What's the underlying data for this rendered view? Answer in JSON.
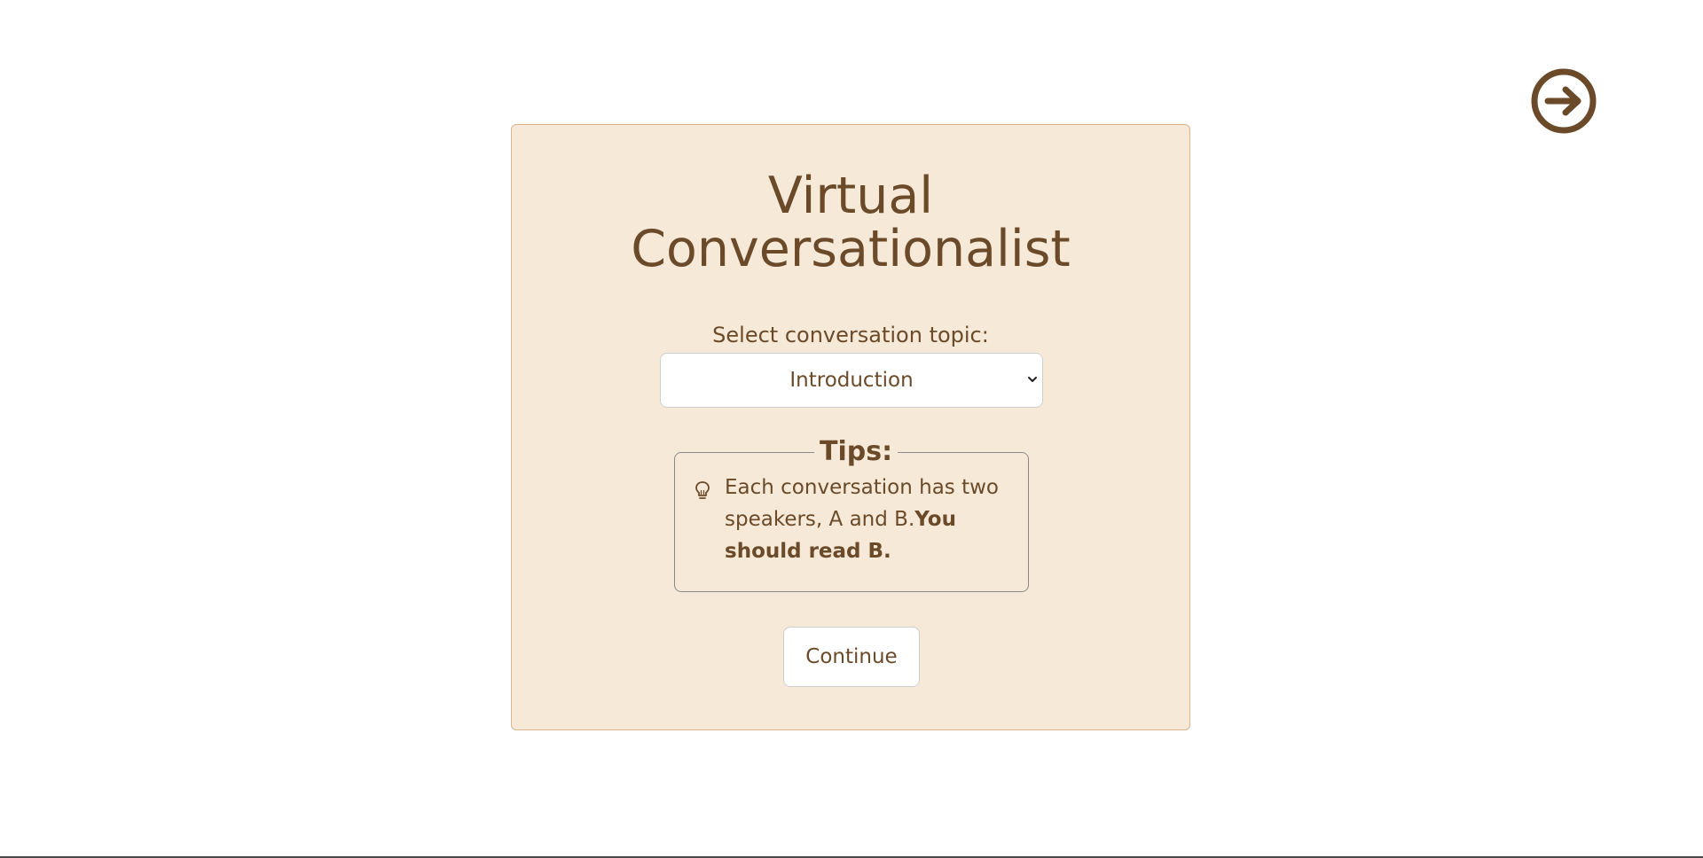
{
  "header": {
    "title_line1": "Virtual",
    "title_line2": "Conversationalist"
  },
  "topic": {
    "label": "Select conversation topic:",
    "selected": "Introduction"
  },
  "tips": {
    "legend": "Tips:",
    "text_normal": "Each conversation has two speakers, A and B.",
    "text_bold": "You should read B."
  },
  "actions": {
    "continue_label": "Continue"
  },
  "icons": {
    "next": "arrow-right-circle-icon",
    "tip": "lightbulb-icon",
    "select": "chevron-down-icon"
  },
  "colors": {
    "accent": "#6b4a2a",
    "card_bg": "#f6e9d7",
    "card_border": "#d9b48f"
  }
}
